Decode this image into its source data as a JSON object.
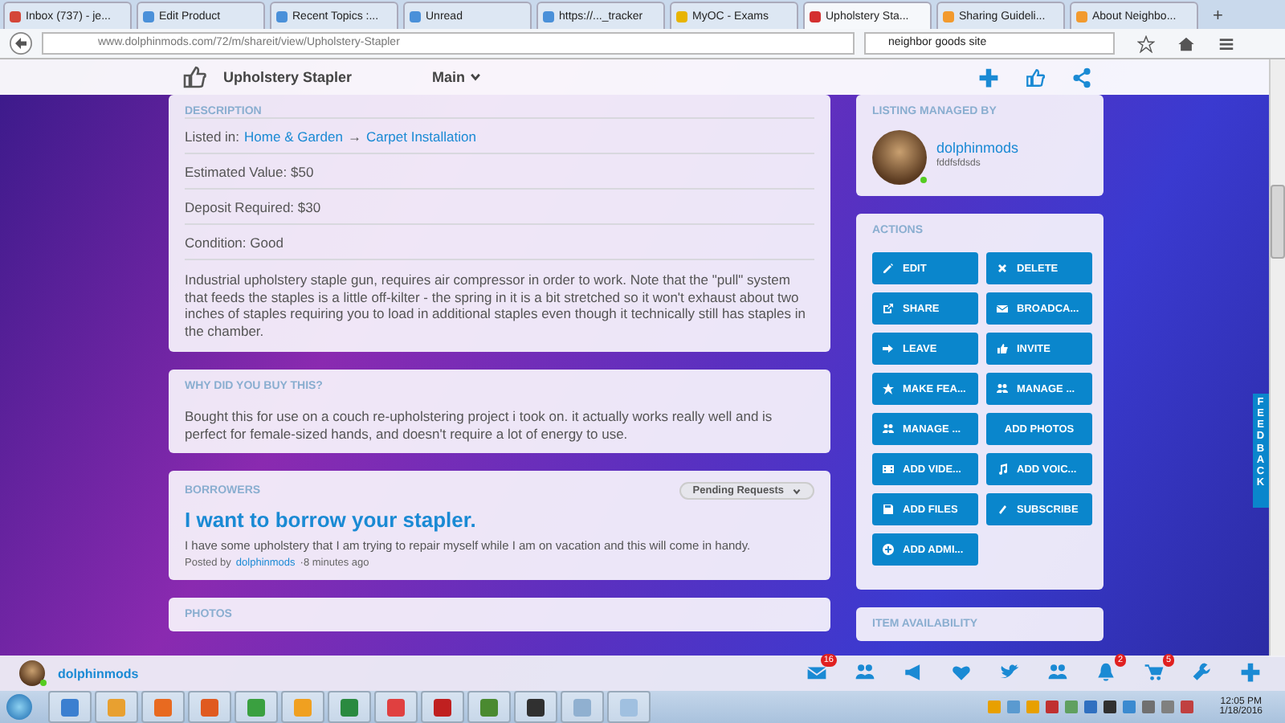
{
  "browser": {
    "tabs": [
      {
        "label": "Inbox (737) - je...",
        "selected": false
      },
      {
        "label": "Edit Product",
        "selected": false
      },
      {
        "label": "Recent Topics :...",
        "selected": false
      },
      {
        "label": "Unread",
        "selected": false
      },
      {
        "label": "https://..._tracker",
        "selected": false
      },
      {
        "label": "MyOC - Exams",
        "selected": false
      },
      {
        "label": "Upholstery Sta...",
        "selected": true
      },
      {
        "label": "Sharing Guideli...",
        "selected": false
      },
      {
        "label": "About Neighbo...",
        "selected": false
      }
    ],
    "new_tab": "+",
    "address": "www.dolphinmods.com/72/m/shareit/view/Upholstery-Stapler",
    "search": "neighbor goods site"
  },
  "header": {
    "title": "Upholstery Stapler",
    "section": "Main"
  },
  "description": {
    "heading": "DESCRIPTION",
    "listed_label": "Listed in:",
    "category": "Home & Garden",
    "separator": "→",
    "subcategory": "Carpet Installation",
    "rows": [
      "Estimated Value: $50",
      "Deposit Required: $30",
      "Condition: Good"
    ],
    "body": "Industrial upholstery staple gun, requires air compressor in order to work. Note that the \"pull\" system that feeds the staples is a little off-kilter - the spring in it is a bit stretched so it won't exhaust about two inches of staples requiring you to load in additional staples even though it technically still has staples in the chamber."
  },
  "why": {
    "heading": "WHY DID YOU BUY THIS?",
    "body": "Bought this for use on a couch re-upholstering project i took on. it actually works really well and is perfect for female-sized hands, and doesn't require a lot of energy to use."
  },
  "borrowers": {
    "heading": "BORROWERS",
    "filter": "Pending Requests",
    "requests": [
      {
        "title": "I want to borrow your stapler.",
        "body": "I have some upholstery that I am trying to repair myself while I am on vacation and this will come in handy.",
        "posted_by": "Posted by",
        "author": "dolphinmods",
        "time": "·8 minutes ago"
      }
    ]
  },
  "photos": {
    "heading": "PHOTOS"
  },
  "manager": {
    "heading": "LISTING MANAGED BY",
    "name": "dolphinmods",
    "subtitle": "fddfsfdsds",
    "online": true
  },
  "actions": {
    "heading": "ACTIONS",
    "buttons": [
      {
        "label": "EDIT",
        "kind": "edit"
      },
      {
        "label": "DELETE",
        "kind": "delete"
      },
      {
        "label": "SHARE",
        "kind": "share"
      },
      {
        "label": "BROADCA...",
        "kind": "mail"
      },
      {
        "label": "LEAVE",
        "kind": "leave"
      },
      {
        "label": "INVITE",
        "kind": "thumb"
      },
      {
        "label": "MAKE FEA...",
        "kind": "star"
      },
      {
        "label": "MANAGE ...",
        "kind": "group"
      },
      {
        "label": "MANAGE ...",
        "kind": "group"
      },
      {
        "label": "ADD PHOTOS",
        "kind": "plain"
      },
      {
        "label": "ADD VIDE...",
        "kind": "film"
      },
      {
        "label": "ADD VOIC...",
        "kind": "music"
      },
      {
        "label": "ADD FILES",
        "kind": "floppy"
      },
      {
        "label": "SUBSCRIBE",
        "kind": "clip"
      },
      {
        "label": "ADD ADMI...",
        "kind": "plus-circle"
      }
    ]
  },
  "availability": {
    "heading": "ITEM AVAILABILITY"
  },
  "feedback": "FEEDBACK",
  "bottom_bar": {
    "user": "dolphinmods",
    "online": true,
    "icons": [
      {
        "kind": "mail",
        "badge": "16"
      },
      {
        "kind": "group"
      },
      {
        "kind": "megaphone"
      },
      {
        "kind": "heart"
      },
      {
        "kind": "bird"
      },
      {
        "kind": "group"
      },
      {
        "kind": "bell",
        "badge": "2"
      },
      {
        "kind": "cart",
        "badge": "5"
      },
      {
        "kind": "wrench"
      },
      {
        "kind": "plus"
      }
    ]
  },
  "taskbar": {
    "time": "12:05 PM",
    "date": "1/18/2016"
  }
}
